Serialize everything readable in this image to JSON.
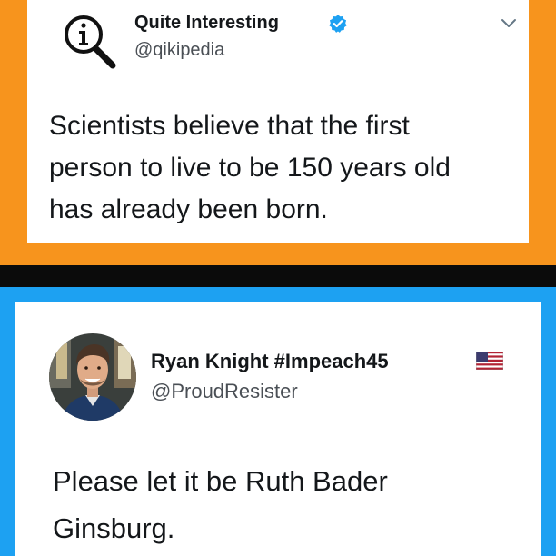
{
  "tweet_qi": {
    "display_name": "Quite Interesting",
    "handle": "@qikipedia",
    "verified": true,
    "logo_icon": "magnifier-i-logo",
    "text_lines": [
      "Scientists believe that the first",
      "person to live to be 150 years old",
      "has already been born."
    ],
    "frame_color": "#f7941d"
  },
  "tweet_reply": {
    "display_name": "Ryan Knight #Impeach45",
    "handle": "@ProudResister",
    "name_emoji": "us-flag-icon",
    "avatar": "profile-photo",
    "text_lines": [
      "Please let it be Ruth Bader",
      "Ginsburg."
    ],
    "frame_color": "#1da1f2"
  },
  "colors": {
    "background": "#0b0b0b",
    "verified_badge": "#1da1f2",
    "text": "#14171a",
    "secondary_text": "#4a4f55"
  }
}
